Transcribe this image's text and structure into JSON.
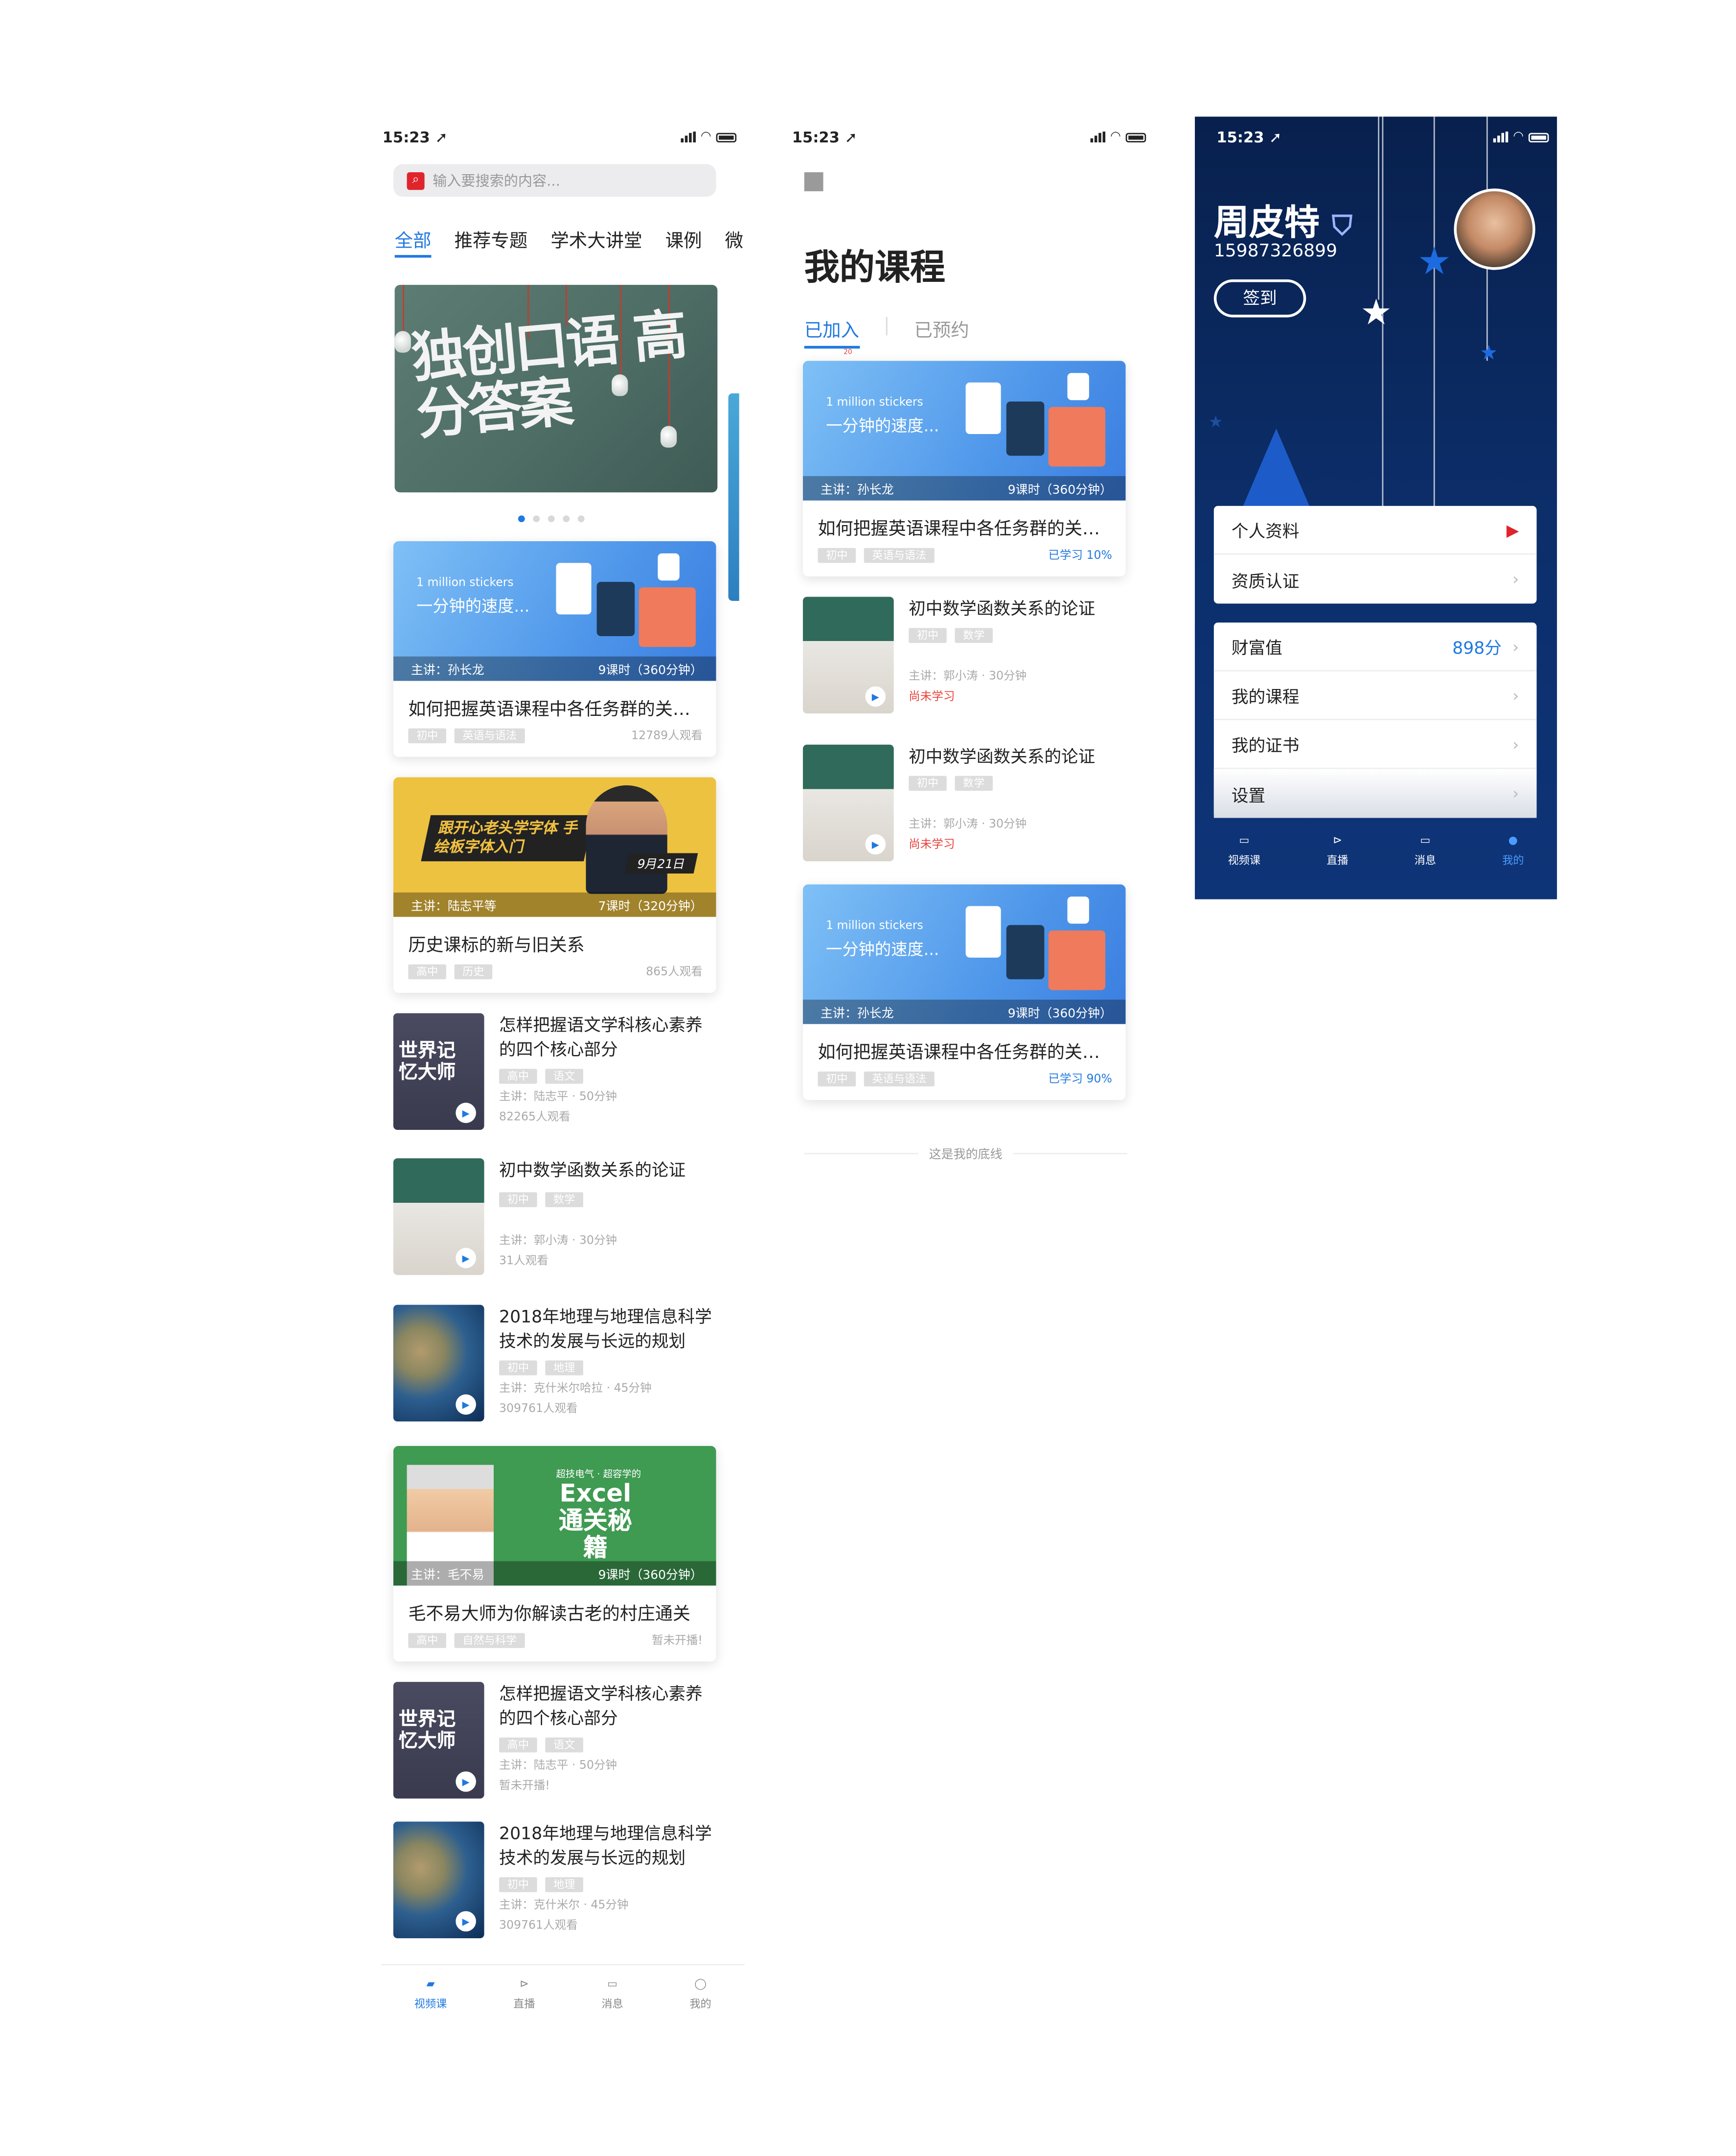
{
  "status": {
    "time": "15:23 ➚"
  },
  "search": {
    "placeholder": "输入要搜索的内容..."
  },
  "tabs": [
    "全部",
    "推荐专题",
    "学术大讲堂",
    "课例",
    "微"
  ],
  "banner": {
    "text": "独创口语 高分答案"
  },
  "cards": [
    {
      "sticker": "1 million stickers",
      "subtitle": "一分钟的速度...",
      "speaker": "主讲：孙长龙",
      "lessons": "9课时（360分钟）",
      "title": "如何把握英语课程中各任务群的关系...",
      "tags": [
        "初中",
        "英语与语法"
      ],
      "meta": "12789人观看"
    },
    {
      "banner_text": "跟开心老头学字体 手绘板字体入门",
      "date": "9月21日",
      "speaker": "主讲：陆志平等",
      "lessons": "7课时（320分钟）",
      "title": "历史课标的新与旧关系",
      "tags": [
        "高中",
        "历史"
      ],
      "meta": "865人观看"
    },
    {
      "banner_small": "超技电气 · 超容学的",
      "banner_text": "Excel 通关秘籍",
      "speaker": "主讲：毛不易",
      "lessons": "9课时（360分钟）",
      "title": "毛不易大师为你解读古老的村庄通关",
      "tags": [
        "高中",
        "自然与科学"
      ],
      "meta": "暂未开播!"
    }
  ],
  "list": [
    {
      "title": "怎样把握语文学科核心素养的四个核心部分",
      "tags": [
        "高中",
        "语文"
      ],
      "speaker": "主讲：陆志平 · 50分钟",
      "meta": "82265人观看",
      "thumb_text": "世界记忆大师"
    },
    {
      "title": "初中数学函数关系的论证",
      "tags": [
        "初中",
        "数学"
      ],
      "speaker": "主讲：郭小涛 · 30分钟",
      "meta": "31人观看"
    },
    {
      "title": "2018年地理与地理信息科学技术的发展与长远的规划",
      "tags": [
        "初中",
        "地理"
      ],
      "speaker": "主讲：克什米尔哈拉 · 45分钟",
      "meta": "309761人观看"
    },
    {
      "title": "怎样把握语文学科核心素养的四个核心部分",
      "tags": [
        "高中",
        "语文"
      ],
      "speaker": "主讲：陆志平 · 50分钟",
      "meta": "暂未开播!",
      "thumb_text": "世界记忆大师"
    },
    {
      "title": "2018年地理与地理信息科学技术的发展与长远的规划",
      "tags": [
        "初中",
        "地理"
      ],
      "speaker": "主讲：克什米尔 · 45分钟",
      "meta": "309761人观看"
    }
  ],
  "tabbar": [
    "视频课",
    "直播",
    "消息",
    "我的"
  ],
  "mycourse": {
    "title": "我的课程",
    "tab_joined": "已加入",
    "tab_reserved": "已预约",
    "badge": "20",
    "card1": {
      "sticker": "1 million stickers",
      "subtitle": "一分钟的速度...",
      "speaker": "主讲：孙长龙",
      "lessons": "9课时（360分钟）",
      "title": "如何把握英语课程中各任务群的关系...",
      "tags": [
        "初中",
        "英语与语法"
      ],
      "progress": "已学习 10%"
    },
    "items": [
      {
        "title": "初中数学函数关系的论证",
        "tags": [
          "初中",
          "数学"
        ],
        "speaker": "主讲：郭小涛 · 30分钟",
        "status": "尚未学习"
      },
      {
        "title": "初中数学函数关系的论证",
        "tags": [
          "初中",
          "数学"
        ],
        "speaker": "主讲：郭小涛 · 30分钟",
        "status": "尚未学习"
      }
    ],
    "card2": {
      "sticker": "1 million stickers",
      "subtitle": "一分钟的速度...",
      "speaker": "主讲：孙长龙",
      "lessons": "9课时（360分钟）",
      "title": "如何把握英语课程中各任务群的关系...",
      "tags": [
        "初中",
        "英语与语法"
      ],
      "progress": "已学习 90%"
    },
    "end": "这是我的底线"
  },
  "profile": {
    "name": "周皮特",
    "phone": "15987326899",
    "sign": "签到",
    "group1": [
      "个人资料",
      "资质认证"
    ],
    "wealth_label": "财富值",
    "wealth_value": "898分",
    "group2": [
      "我的课程",
      "我的证书",
      "设置"
    ]
  },
  "colors": {
    "accent": "#2079e0",
    "red": "#e8413a",
    "navy": "#0c2f6c"
  }
}
